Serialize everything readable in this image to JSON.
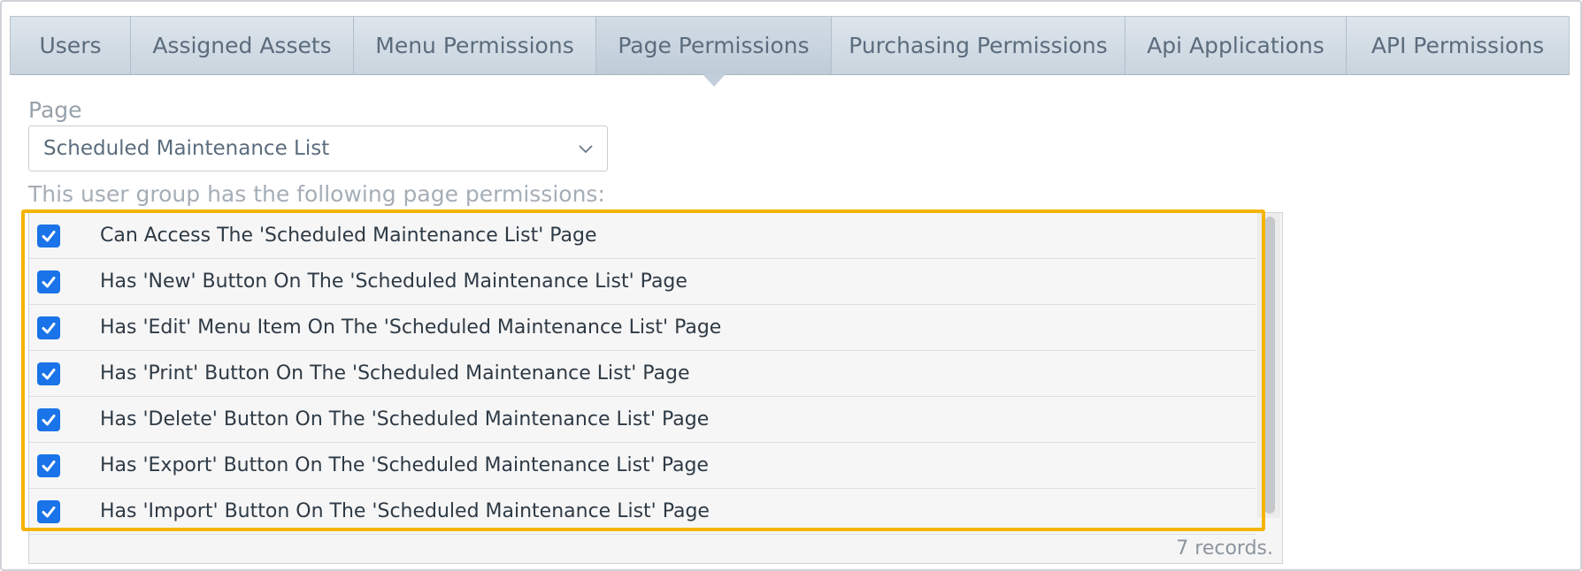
{
  "tabs": [
    {
      "label": "Users",
      "active": false
    },
    {
      "label": "Assigned Assets",
      "active": false
    },
    {
      "label": "Menu Permissions",
      "active": false
    },
    {
      "label": "Page Permissions",
      "active": true
    },
    {
      "label": "Purchasing Permissions",
      "active": false
    },
    {
      "label": "Api Applications",
      "active": false
    },
    {
      "label": "API Permissions",
      "active": false
    }
  ],
  "page_field": {
    "label": "Page",
    "selected": "Scheduled Maintenance List"
  },
  "description": "This user group has the following page permissions:",
  "permissions": [
    {
      "label": "Can Access The 'Scheduled Maintenance List' Page",
      "checked": true
    },
    {
      "label": "Has 'New' Button On The 'Scheduled Maintenance List' Page",
      "checked": true
    },
    {
      "label": "Has 'Edit' Menu Item On The 'Scheduled Maintenance List' Page",
      "checked": true
    },
    {
      "label": "Has 'Print' Button On The 'Scheduled Maintenance List' Page",
      "checked": true
    },
    {
      "label": "Has 'Delete' Button On The 'Scheduled Maintenance List' Page",
      "checked": true
    },
    {
      "label": "Has 'Export' Button On The 'Scheduled Maintenance List' Page",
      "checked": true
    },
    {
      "label": "Has 'Import' Button On The 'Scheduled Maintenance List' Page",
      "checked": true
    }
  ],
  "records_text": "7 records.",
  "colors": {
    "checkbox": "#1a73e8",
    "highlight": "#f4b400"
  }
}
